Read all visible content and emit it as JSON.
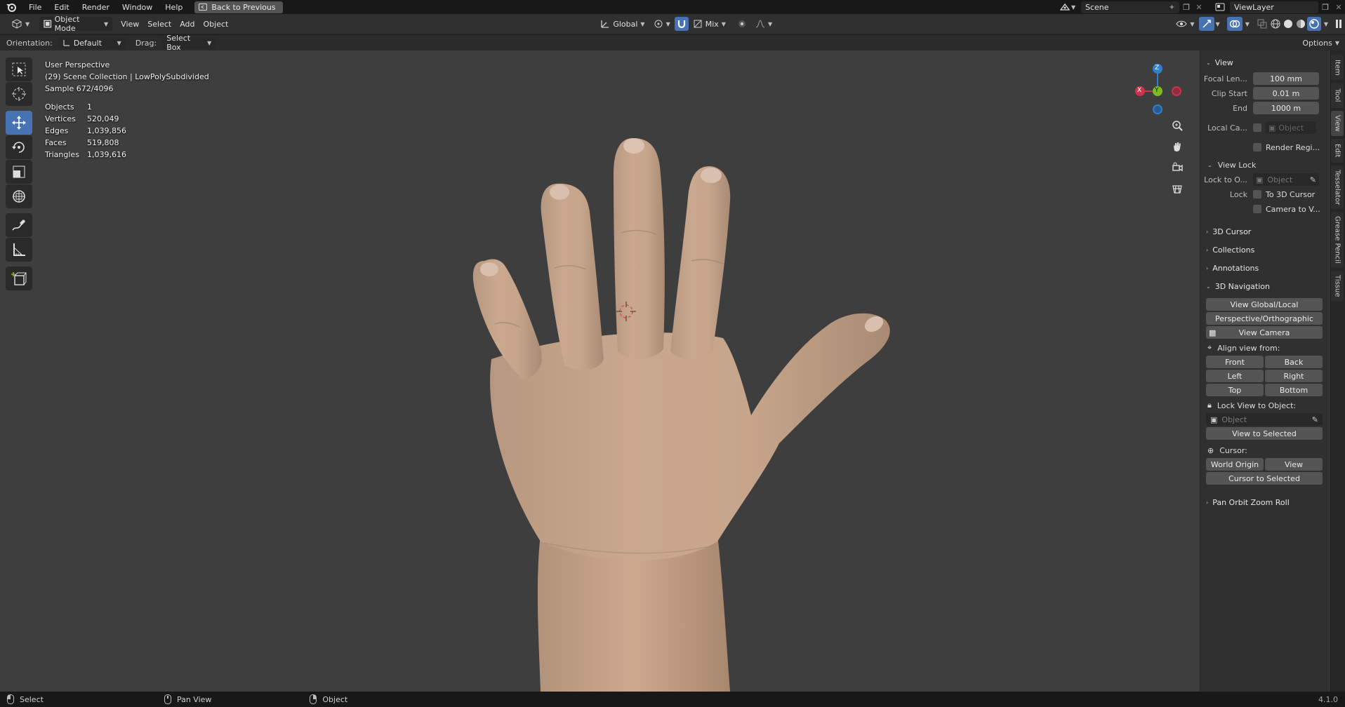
{
  "topbar": {
    "menus": [
      "File",
      "Edit",
      "Render",
      "Window",
      "Help"
    ],
    "back_label": "Back to Previous",
    "scene": "Scene",
    "view_layer": "ViewLayer"
  },
  "header": {
    "mode": "Object Mode",
    "menus": [
      "View",
      "Select",
      "Add",
      "Object"
    ],
    "transform_orientation": "Global",
    "snap_mode": "Mix"
  },
  "tool_settings": {
    "orientation_label": "Orientation:",
    "orientation_value": "Default",
    "drag_label": "Drag:",
    "drag_value": "Select Box",
    "options_label": "Options"
  },
  "viewport_info": {
    "perspective": "User Perspective",
    "collection": "(29) Scene Collection | LowPolySubdivided",
    "sample": "Sample 672/4096",
    "stats": [
      {
        "label": "Objects",
        "value": "1"
      },
      {
        "label": "Vertices",
        "value": "520,049"
      },
      {
        "label": "Edges",
        "value": "1,039,856"
      },
      {
        "label": "Faces",
        "value": "519,808"
      },
      {
        "label": "Triangles",
        "value": "1,039,616"
      }
    ]
  },
  "gizmo": {
    "x": "X",
    "y": "Y",
    "z": "Z",
    "x_color": "#d0314a",
    "y_color": "#7dbb1f",
    "z_color": "#2f7fd1"
  },
  "sidebar": {
    "view_header": "View",
    "focal_label": "Focal Len...",
    "focal_value": "100 mm",
    "clip_start_label": "Clip Start",
    "clip_start_value": "0.01 m",
    "clip_end_label": "End",
    "clip_end_value": "1000 m",
    "local_cam_label": "Local Ca...",
    "local_cam_placeholder": "Object",
    "render_region_label": "Render Regi...",
    "view_lock_header": "View Lock",
    "lock_to_label": "Lock to O...",
    "lock_to_placeholder": "Object",
    "lock_label": "Lock",
    "to_3d_cursor": "To 3D Cursor",
    "camera_to_view": "Camera to V...",
    "cursor_panel": "3D Cursor",
    "collections_panel": "Collections",
    "annotations_panel": "Annotations",
    "nav_panel": "3D Navigation",
    "view_global_local": "View Global/Local",
    "persp_ortho": "Perspective/Orthographic",
    "view_camera": "View Camera",
    "align_view_label": "Align view from:",
    "front": "Front",
    "back": "Back",
    "left": "Left",
    "right": "Right",
    "top": "Top",
    "bottom": "Bottom",
    "lock_view_label": "Lock View to Object:",
    "lock_view_placeholder": "Object",
    "view_to_selected": "View to Selected",
    "cursor_label": "Cursor:",
    "world_origin": "World Origin",
    "view": "View",
    "cursor_to_selected": "Cursor to Selected",
    "pan_orbit_panel": "Pan Orbit Zoom Roll"
  },
  "tabs": [
    "Item",
    "Tool",
    "View",
    "Edit",
    "Tesselator",
    "Grease Pencil",
    "Tissue"
  ],
  "statusbar": {
    "select": "Select",
    "pan_view": "Pan View",
    "object": "Object",
    "version": "4.1.0"
  }
}
